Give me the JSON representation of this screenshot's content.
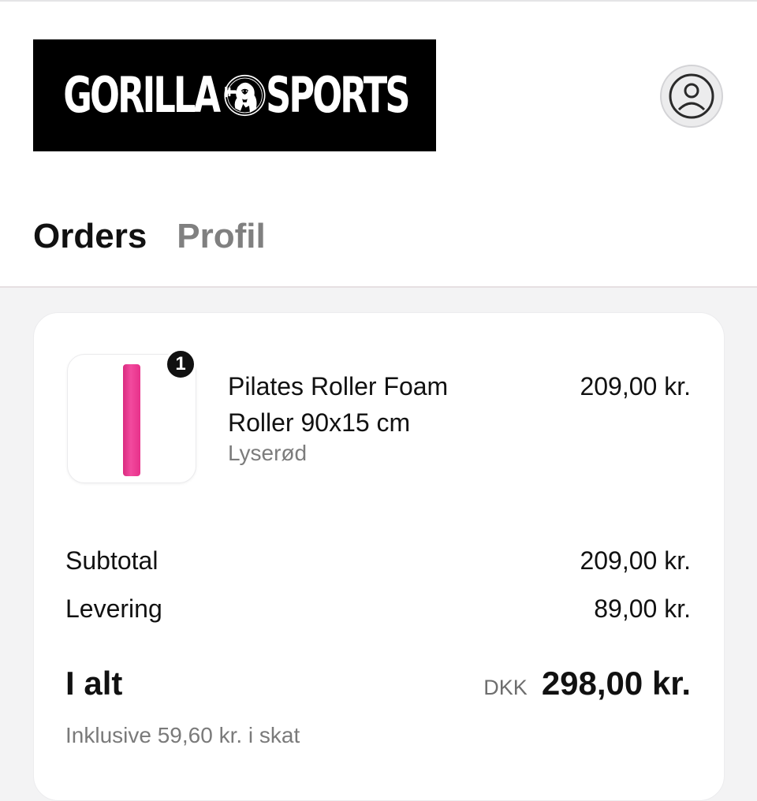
{
  "brand": {
    "logo_left": "GORILLA",
    "logo_right": "SPORTS"
  },
  "account_icon": "user-circle-icon",
  "tabs": [
    {
      "label": "Orders",
      "active": true
    },
    {
      "label": "Profil",
      "active": false
    }
  ],
  "order": {
    "items": [
      {
        "quantity": "1",
        "name": "Pilates Roller Foam Roller 90x15 cm",
        "variant": "Lyserød",
        "price": "209,00 kr.",
        "color": "#e7318a"
      }
    ],
    "subtotal": {
      "label": "Subtotal",
      "value": "209,00 kr."
    },
    "shipping": {
      "label": "Levering",
      "value": "89,00 kr."
    },
    "total": {
      "label": "I alt",
      "currency": "DKK",
      "value": "298,00 kr."
    },
    "tax_note": "Inklusive 59,60 kr. i skat"
  }
}
